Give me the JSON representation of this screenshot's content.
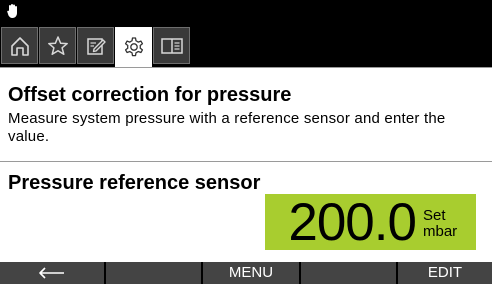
{
  "status_bar": {
    "indicator_icon": "hand-icon"
  },
  "tabs": [
    {
      "name": "home",
      "icon": "home-icon",
      "active": false
    },
    {
      "name": "favorites",
      "icon": "star-icon",
      "active": false
    },
    {
      "name": "edit",
      "icon": "edit-icon",
      "active": false
    },
    {
      "name": "settings",
      "icon": "gear-icon",
      "active": true
    },
    {
      "name": "manual",
      "icon": "book-icon",
      "active": false
    }
  ],
  "info": {
    "title": "Offset correction for pressure",
    "description": "Measure system pressure with a reference sensor and enter the value."
  },
  "parameter": {
    "label": "Pressure reference sensor",
    "value": "200.0",
    "state": "Set",
    "unit": "mbar"
  },
  "softkeys": [
    {
      "icon": "back-arrow-icon",
      "label": ""
    },
    {
      "label": ""
    },
    {
      "label": "MENU"
    },
    {
      "label": ""
    },
    {
      "label": "EDIT"
    }
  ],
  "colors": {
    "value_background": "#a8cd2f",
    "bar_background": "#000000",
    "softkey_background": "#444444"
  }
}
